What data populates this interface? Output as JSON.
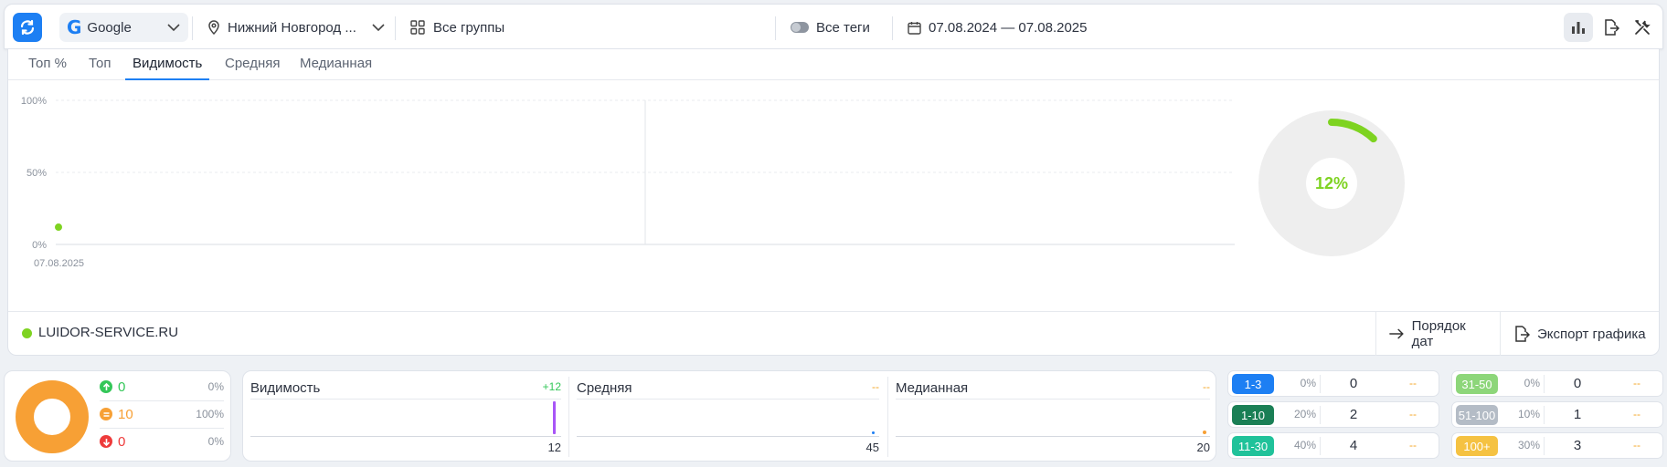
{
  "toolbar": {
    "engine": {
      "logo": "G",
      "label": "Google",
      "icon": "google-logo"
    },
    "region": {
      "label": "Нижний Новгород ...",
      "icon": "location-pin-icon"
    },
    "groups": {
      "label": "Все группы",
      "icon": "grid-icon"
    },
    "tags": {
      "label": "Все теги",
      "icon": "toggle-icon"
    },
    "dates": {
      "label": "07.08.2024 — 07.08.2025",
      "icon": "calendar-icon"
    },
    "accent": "#1d7ff3"
  },
  "tabs": [
    {
      "label": "Топ %",
      "active": false
    },
    {
      "label": "Топ",
      "active": false
    },
    {
      "label": "Видимость",
      "active": true
    },
    {
      "label": "Средняя",
      "active": false
    },
    {
      "label": "Медианная",
      "active": false
    }
  ],
  "chart_data": {
    "type": "line",
    "yticks": [
      "100%",
      "50%",
      "0%"
    ],
    "ylim": [
      0,
      100
    ],
    "x": [
      "07.08.2025"
    ],
    "series": [
      {
        "name": "LUIDOR-SERVICE.RU",
        "color": "#7ed321",
        "values": [
          12
        ]
      }
    ],
    "grid": true,
    "gauge": {
      "value": 12,
      "label": "12%",
      "color": "#7ed321",
      "track_color": "#eeeeee"
    }
  },
  "legend": {
    "site": "LUIDOR-SERVICE.RU",
    "date_order_label": "Порядок дат",
    "export_label": "Экспорт графика"
  },
  "summary": {
    "donut_color": "#f7a035",
    "rows": [
      {
        "count": "0",
        "pct": "0%",
        "color": "#34c759",
        "icon": "arrow-up-icon"
      },
      {
        "count": "10",
        "pct": "100%",
        "color": "#f7a035",
        "icon": "equals-icon"
      },
      {
        "count": "0",
        "pct": "0%",
        "color": "#ee3b3b",
        "icon": "arrow-down-icon"
      }
    ]
  },
  "metrics": [
    {
      "title": "Видимость",
      "delta": "+12",
      "delta_color": "#34c759",
      "value": "12",
      "marker_color": "#a855f7"
    },
    {
      "title": "Средняя",
      "delta": "--",
      "delta_color": "#f5a623",
      "value": "45",
      "marker_color": "#1d7ff3"
    },
    {
      "title": "Медианная",
      "delta": "--",
      "delta_color": "#f5a623",
      "value": "20",
      "marker_color": "#f7a035"
    }
  ],
  "ranges": [
    {
      "label": "1-3",
      "pct": "0%",
      "count": "0",
      "delta": "--",
      "color": "#1d7ff3"
    },
    {
      "label": "1-10",
      "pct": "20%",
      "count": "2",
      "delta": "--",
      "color": "#1a7f55"
    },
    {
      "label": "11-30",
      "pct": "40%",
      "count": "4",
      "delta": "--",
      "color": "#20c29a"
    },
    {
      "label": "31-50",
      "pct": "0%",
      "count": "0",
      "delta": "--",
      "color": "#8dd67a"
    },
    {
      "label": "51-100",
      "pct": "10%",
      "count": "1",
      "delta": "--",
      "color": "#b4bcc6"
    },
    {
      "label": "100+",
      "pct": "30%",
      "count": "3",
      "delta": "--",
      "color": "#f5c242"
    }
  ]
}
